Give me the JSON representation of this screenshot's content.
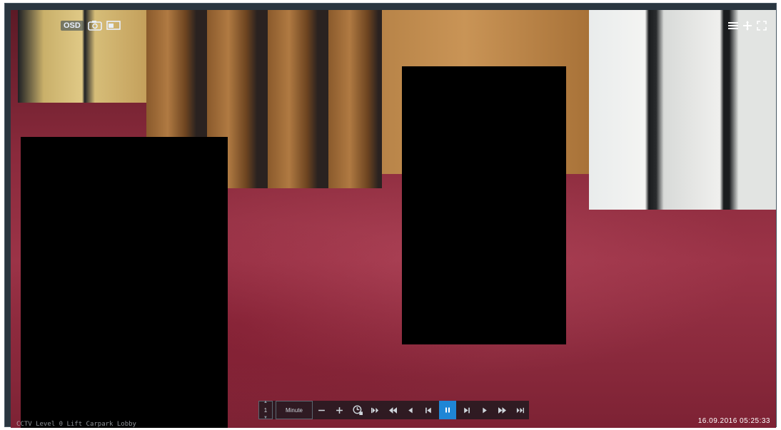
{
  "overlay": {
    "osd_label": "OSD",
    "camera_title": "CCTV Level 0 Lift Carpark Lobby"
  },
  "playback": {
    "speed": "1",
    "step_unit": "Minute",
    "timestamp": "16.09.2016   05:25:33"
  },
  "icons": {
    "snapshot": "camera-icon",
    "window": "window-icon",
    "menu": "menu-icon",
    "ptz": "move-icon",
    "fullscreen": "fullscreen-icon",
    "zoom_out": "minus-icon",
    "zoom_in": "plus-icon",
    "time_jump": "clock-icon",
    "prev_segment": "skip-start-icon",
    "rewind": "rewind-icon",
    "step_back": "step-back-icon",
    "prev_frame": "frame-back-icon",
    "pause": "pause-icon",
    "next_frame": "frame-forward-icon",
    "play": "play-icon",
    "fast_forward": "fast-forward-icon",
    "next_segment": "skip-end-icon"
  },
  "colors": {
    "accent": "#1f86d6",
    "redaction": "#000000"
  }
}
